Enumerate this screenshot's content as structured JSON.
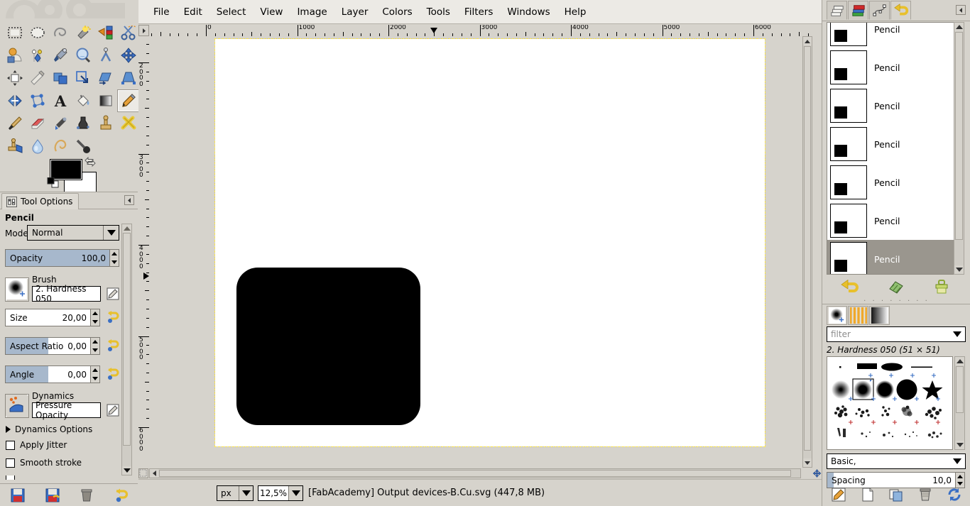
{
  "app": {
    "status_bar": {
      "unit": "px",
      "zoom": "12,5%",
      "title": "[FabAcademy] Output devices-B.Cu.svg (447,8 MB)"
    }
  },
  "menubar": {
    "items": [
      {
        "label": "File"
      },
      {
        "label": "Edit"
      },
      {
        "label": "Select"
      },
      {
        "label": "View"
      },
      {
        "label": "Image"
      },
      {
        "label": "Layer"
      },
      {
        "label": "Colors"
      },
      {
        "label": "Tools"
      },
      {
        "label": "Filters"
      },
      {
        "label": "Windows"
      },
      {
        "label": "Help"
      }
    ]
  },
  "toolbox": {
    "tools": [
      {
        "name": "rectangle-select-tool",
        "active": false
      },
      {
        "name": "ellipse-select-tool",
        "active": false
      },
      {
        "name": "free-select-tool",
        "active": false
      },
      {
        "name": "fuzzy-select-tool",
        "active": false
      },
      {
        "name": "select-by-color-tool",
        "active": false
      },
      {
        "name": "scissors-select-tool",
        "active": false
      },
      {
        "name": "foreground-select-tool",
        "active": false
      },
      {
        "name": "paths-tool",
        "active": false
      },
      {
        "name": "color-picker-tool",
        "active": false
      },
      {
        "name": "zoom-tool",
        "active": false
      },
      {
        "name": "measure-tool",
        "active": false
      },
      {
        "name": "move-tool",
        "active": false
      },
      {
        "name": "align-tool",
        "active": false
      },
      {
        "name": "crop-tool",
        "active": false
      },
      {
        "name": "rotate-tool",
        "active": false
      },
      {
        "name": "scale-tool",
        "active": false
      },
      {
        "name": "shear-tool",
        "active": false
      },
      {
        "name": "perspective-tool",
        "active": false
      },
      {
        "name": "flip-tool",
        "active": false
      },
      {
        "name": "cage-transform-tool",
        "active": false
      },
      {
        "name": "text-tool",
        "active": false
      },
      {
        "name": "bucket-fill-tool",
        "active": false
      },
      {
        "name": "gradient-tool",
        "active": false
      },
      {
        "name": "pencil-tool",
        "active": true
      },
      {
        "name": "paintbrush-tool",
        "active": false
      },
      {
        "name": "eraser-tool",
        "active": false
      },
      {
        "name": "airbrush-tool",
        "active": false
      },
      {
        "name": "ink-tool",
        "active": false
      },
      {
        "name": "clone-tool",
        "active": false
      },
      {
        "name": "heal-tool",
        "active": false
      },
      {
        "name": "perspective-clone-tool",
        "active": false
      },
      {
        "name": "blur-sharpen-tool",
        "active": false
      },
      {
        "name": "smudge-tool",
        "active": false
      },
      {
        "name": "dodge-burn-tool",
        "active": false
      }
    ],
    "colors": {
      "foreground": "#000000",
      "background": "#ffffff"
    }
  },
  "tool_options": {
    "tab_label": "Tool Options",
    "tool_name": "Pencil",
    "mode": {
      "label": "Mode:",
      "value": "Normal"
    },
    "opacity": {
      "label": "Opacity",
      "value": "100,0",
      "fill_percent": 100
    },
    "brush": {
      "label": "Brush",
      "value": "2. Hardness 050"
    },
    "size": {
      "label": "Size",
      "value": "20,00",
      "fill_percent": 0
    },
    "aspect_ratio": {
      "label": "Aspect Ratio",
      "value": "0,00",
      "fill_percent": 50
    },
    "angle": {
      "label": "Angle",
      "value": "0,00",
      "fill_percent": 50
    },
    "dynamics": {
      "label": "Dynamics",
      "value": "Pressure Opacity"
    },
    "dynamics_options": {
      "label": "Dynamics Options"
    },
    "apply_jitter": {
      "label": "Apply Jitter",
      "checked": false
    },
    "smooth_stroke": {
      "label": "Smooth stroke",
      "checked": false
    }
  },
  "right_dock": {
    "tabs": [
      {
        "name": "layers-tab",
        "selected": false
      },
      {
        "name": "channels-tab",
        "selected": false
      },
      {
        "name": "paths-tab",
        "selected": false
      },
      {
        "name": "undo-history-tab",
        "selected": true
      }
    ],
    "undo_history": [
      {
        "label": "Pencil",
        "selected": false
      },
      {
        "label": "Pencil",
        "selected": false
      },
      {
        "label": "Pencil",
        "selected": false
      },
      {
        "label": "Pencil",
        "selected": false
      },
      {
        "label": "Pencil",
        "selected": false
      },
      {
        "label": "Pencil",
        "selected": false
      },
      {
        "label": "Pencil",
        "selected": true
      }
    ],
    "undo_buttons": [
      {
        "name": "undo-button"
      },
      {
        "name": "redo-button"
      },
      {
        "name": "clear-undo-history-button"
      }
    ]
  },
  "brushes_dock": {
    "tabs": [
      {
        "name": "brushes-tab",
        "selected": true
      },
      {
        "name": "patterns-tab",
        "selected": false
      },
      {
        "name": "gradients-tab",
        "selected": false
      }
    ],
    "filter_placeholder": "filter",
    "selected_brush": "2. Hardness 050 (51 × 51)",
    "tag_filter": "Basic,",
    "spacing": {
      "label": "Spacing",
      "value": "10,0"
    },
    "buttons": [
      {
        "name": "edit-brush-button"
      },
      {
        "name": "new-brush-button"
      },
      {
        "name": "duplicate-brush-button"
      },
      {
        "name": "delete-brush-button"
      },
      {
        "name": "refresh-brushes-button"
      }
    ]
  },
  "rulers": {
    "horizontal_labels": [
      "0",
      "1000",
      "2000",
      "3000",
      "4000",
      "5000",
      "6000"
    ],
    "vertical_labels": [
      "2000",
      "3000",
      "4000",
      "5000",
      "6000"
    ]
  }
}
